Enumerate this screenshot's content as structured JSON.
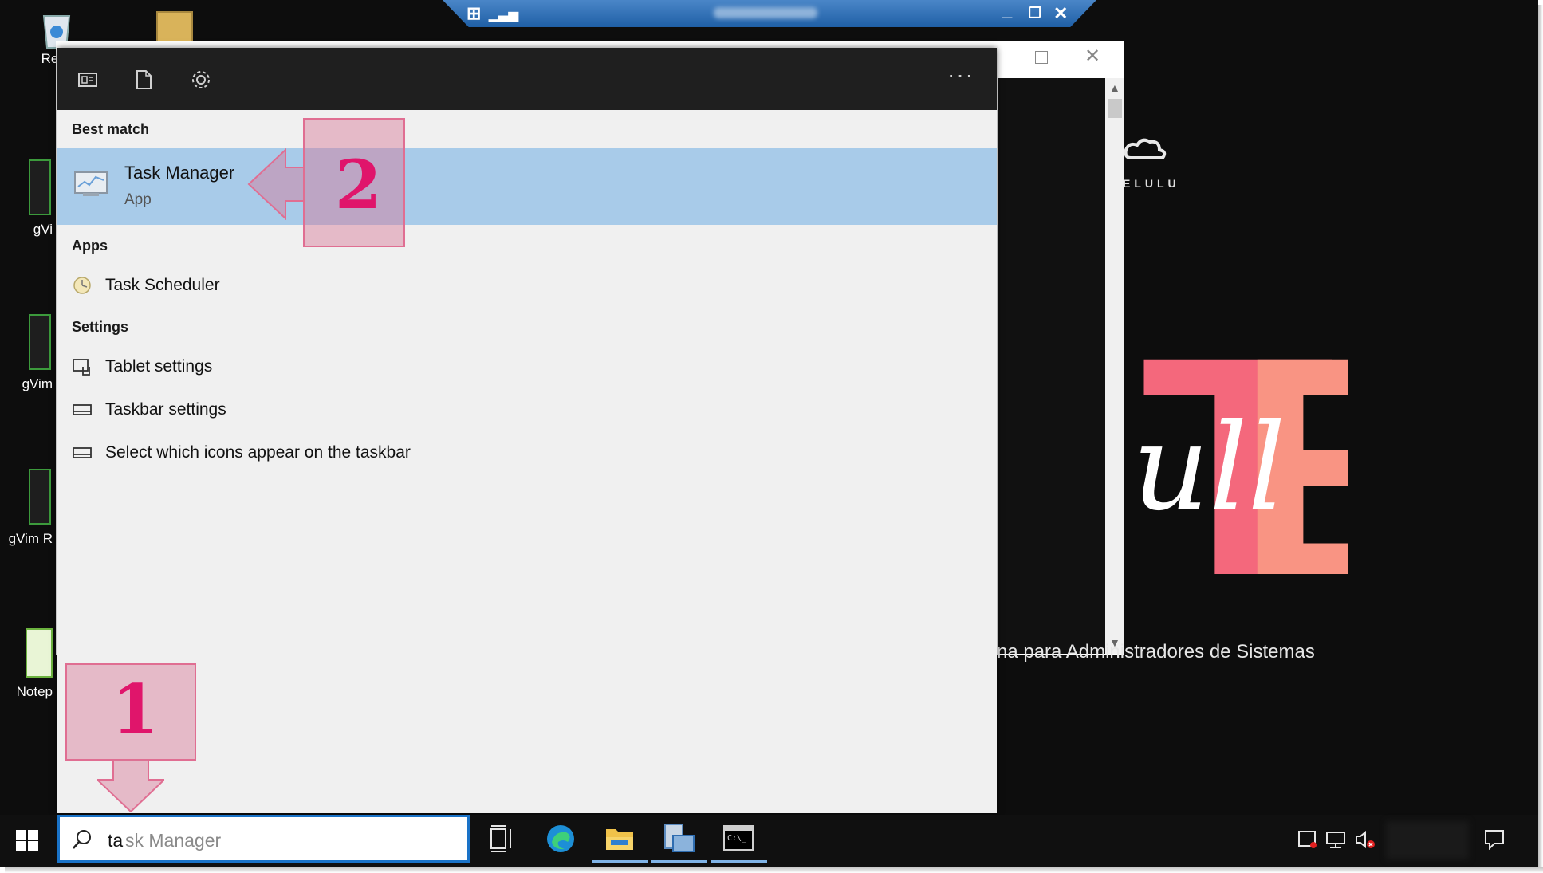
{
  "desktop": {
    "icons": [
      {
        "label": "Recy"
      },
      {
        "label": "gVi"
      },
      {
        "label": "gVim"
      },
      {
        "label": "gVim R"
      },
      {
        "label": "Notep"
      }
    ]
  },
  "background_window": {
    "brand": "ELULU",
    "subtitle": "na para Administradores de Sistemas"
  },
  "search_panel": {
    "more_label": "···",
    "sections": {
      "best_match": "Best match",
      "apps": "Apps",
      "settings": "Settings"
    },
    "best_match": {
      "title": "Task Manager",
      "subtitle": "App"
    },
    "apps": [
      {
        "label": "Task Scheduler"
      }
    ],
    "settings": [
      {
        "label": "Tablet settings"
      },
      {
        "label": "Taskbar settings"
      },
      {
        "label": "Select which icons appear on the taskbar"
      }
    ]
  },
  "annotations": {
    "step1": "1",
    "step2": "2"
  },
  "taskbar": {
    "search_typed": "ta",
    "search_placeholder": "sk Manager"
  },
  "colors": {
    "highlight": "#a8cbe9",
    "accent": "#1a73c8",
    "annotation": "#e0156b"
  },
  "icons": [
    "timeline-icon",
    "document-icon",
    "gear-icon",
    "search-icon",
    "windows-start-icon",
    "task-view-icon",
    "edge-icon",
    "file-explorer-icon",
    "server-manager-icon",
    "terminal-icon",
    "network-icon",
    "volume-muted-icon",
    "notification-icon"
  ]
}
